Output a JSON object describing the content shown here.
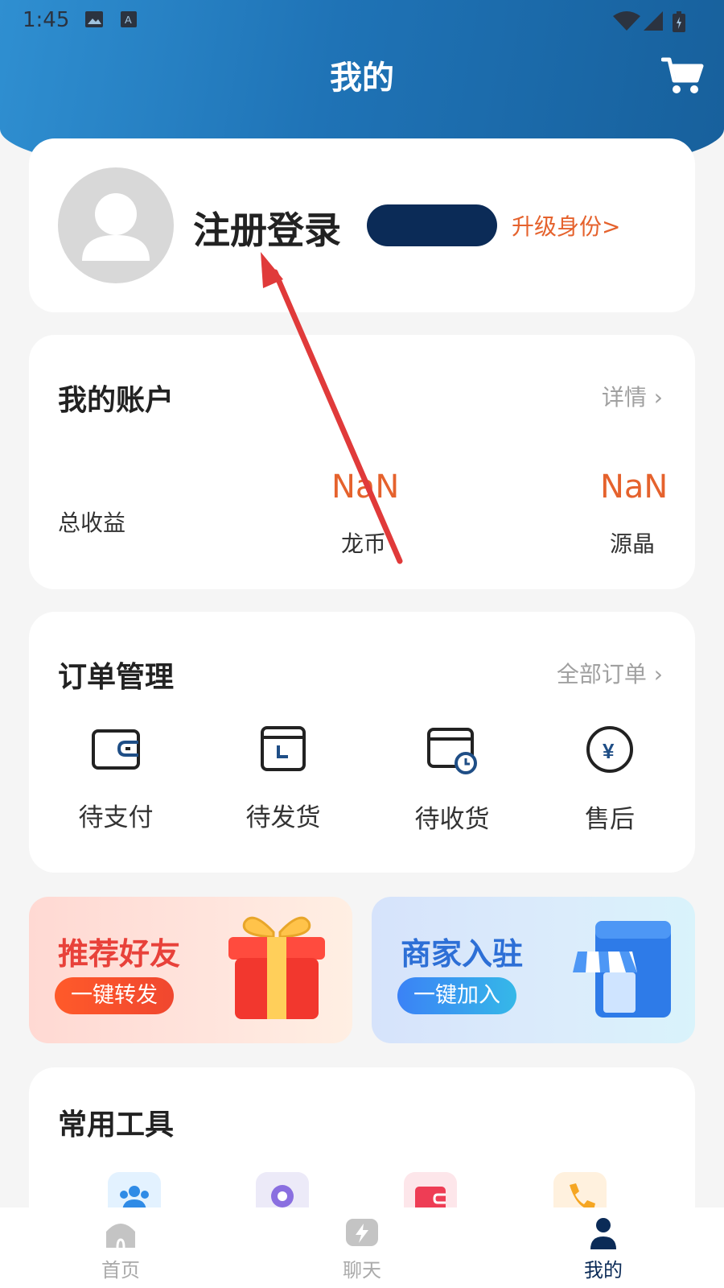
{
  "status_bar": {
    "time": "1:45"
  },
  "header": {
    "title": "我的"
  },
  "profile": {
    "login_label": "注册登录",
    "upgrade_label": "升级身份>"
  },
  "account": {
    "title": "我的账户",
    "detail_link": "详情",
    "total_label": "总收益",
    "items": [
      {
        "value": "NaN",
        "label": "龙币"
      },
      {
        "value": "NaN",
        "label": "源晶"
      }
    ]
  },
  "orders": {
    "title": "订单管理",
    "all_link": "全部订单",
    "items": [
      {
        "label": "待支付",
        "icon": "wallet-icon"
      },
      {
        "label": "待发货",
        "icon": "package-icon"
      },
      {
        "label": "待收货",
        "icon": "calendar-clock-icon"
      },
      {
        "label": "售后",
        "icon": "yen-icon"
      }
    ]
  },
  "promos": [
    {
      "title": "推荐好友",
      "button": "一键转发",
      "icon": "gift-icon"
    },
    {
      "title": "商家入驻",
      "button": "一键加入",
      "icon": "shop-icon"
    }
  ],
  "tools": {
    "title": "常用工具"
  },
  "tabbar": {
    "items": [
      {
        "label": "首页",
        "icon": "home-icon"
      },
      {
        "label": "聊天",
        "icon": "chat-icon"
      },
      {
        "label": "我的",
        "icon": "user-icon",
        "active": true
      }
    ]
  },
  "colors": {
    "accent": "#e5622d",
    "brand_dark": "#0b2b57",
    "header_blue": "#1f73b6"
  }
}
